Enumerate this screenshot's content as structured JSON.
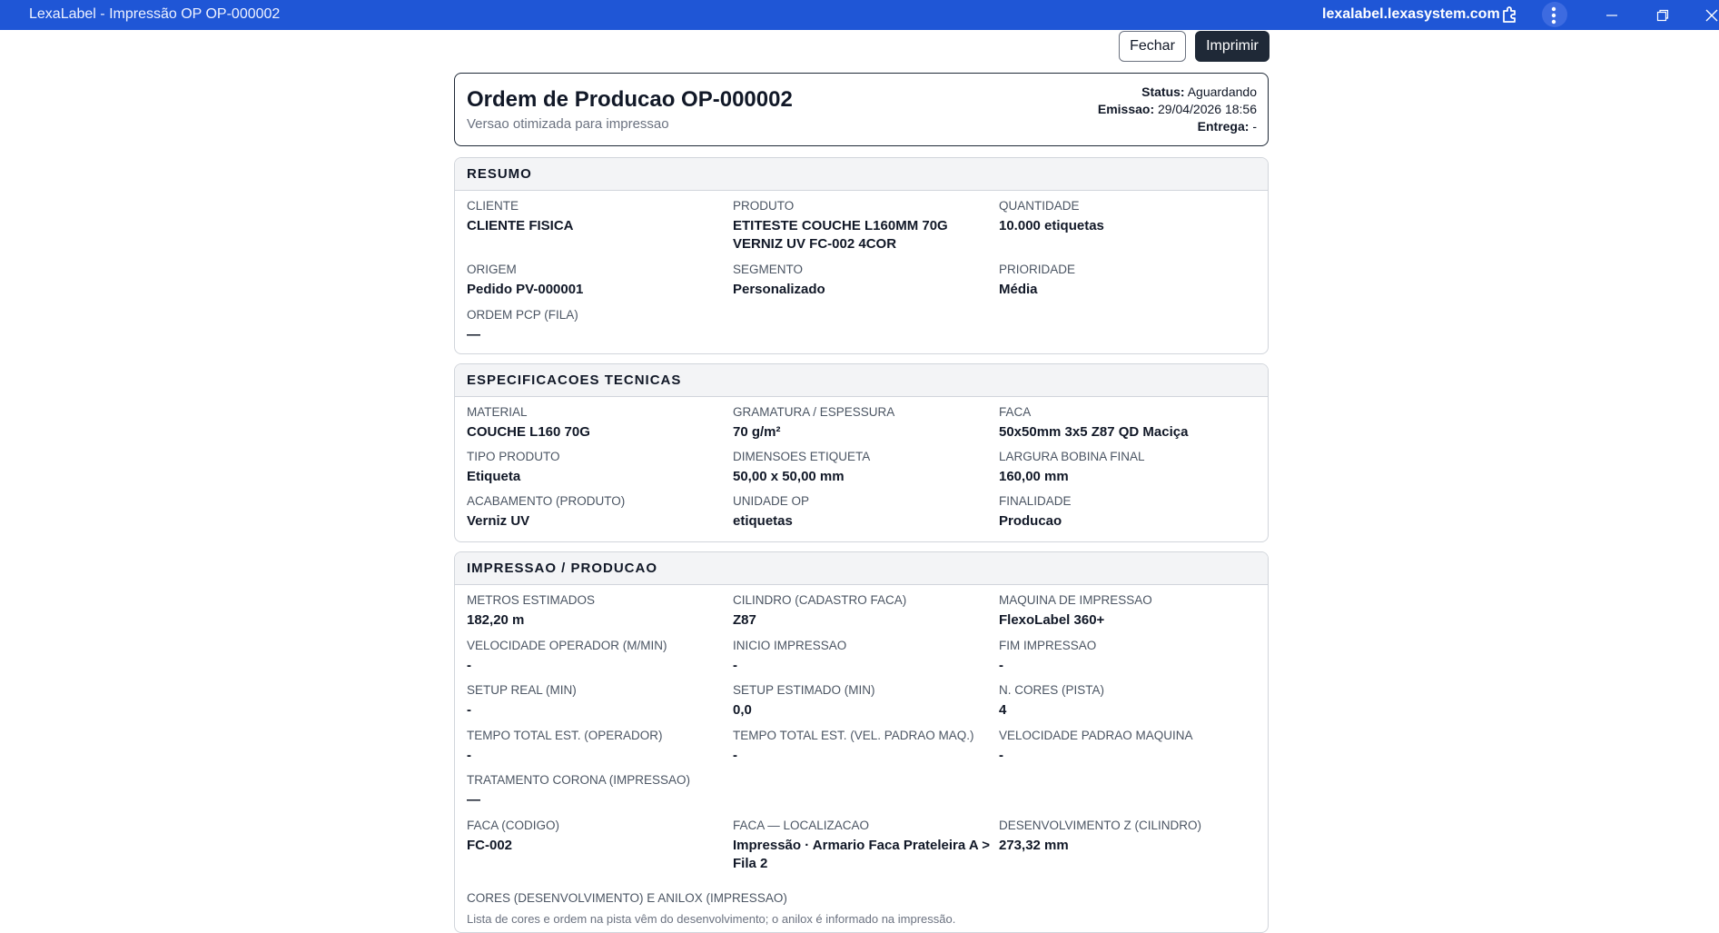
{
  "window": {
    "title": "LexaLabel - Impressão OP OP-000002",
    "domain": "lexalabel.lexasystem.com",
    "icons": [
      "extension-icon",
      "more-vert-icon",
      "minimize-icon",
      "restore-icon",
      "close-icon"
    ]
  },
  "toolbar": {
    "close_label": "Fechar",
    "print_label": "Imprimir"
  },
  "header": {
    "title": "Ordem de Producao OP-000002",
    "subtitle": "Versao otimizada para impressao",
    "status_label": "Status:",
    "status_value": "Aguardando",
    "emissao_label": "Emissao:",
    "emissao_value": "29/04/2026 18:56",
    "entrega_label": "Entrega:",
    "entrega_value": "-"
  },
  "resumo": {
    "title": "RESUMO",
    "fields": [
      {
        "label": "CLIENTE",
        "value": "CLIENTE FISICA"
      },
      {
        "label": "PRODUTO",
        "value": "ETITESTE COUCHE L160MM 70G VERNIZ UV FC-002 4COR"
      },
      {
        "label": "QUANTIDADE",
        "value": "10.000 etiquetas"
      },
      {
        "label": "ORIGEM",
        "value": "Pedido PV-000001"
      },
      {
        "label": "SEGMENTO",
        "value": "Personalizado"
      },
      {
        "label": "PRIORIDADE",
        "value": "Média"
      },
      {
        "label": "ORDEM PCP (FILA)",
        "value": "—"
      }
    ]
  },
  "specs": {
    "title": "ESPECIFICACOES TECNICAS",
    "fields": [
      {
        "label": "MATERIAL",
        "value": "COUCHE L160 70G"
      },
      {
        "label": "GRAMATURA / ESPESSURA",
        "value": "70 g/m²"
      },
      {
        "label": "FACA",
        "value": "50x50mm 3x5 Z87 QD Maciça"
      },
      {
        "label": "TIPO PRODUTO",
        "value": "Etiqueta"
      },
      {
        "label": "DIMENSOES ETIQUETA",
        "value": "50,00 x 50,00 mm"
      },
      {
        "label": "LARGURA BOBINA FINAL",
        "value": "160,00 mm"
      },
      {
        "label": "ACABAMENTO (PRODUTO)",
        "value": "Verniz UV"
      },
      {
        "label": "UNIDADE OP",
        "value": "etiquetas"
      },
      {
        "label": "FINALIDADE",
        "value": "Producao"
      }
    ]
  },
  "impressao": {
    "title": "IMPRESSAO / PRODUCAO",
    "fields": [
      {
        "label": "METROS ESTIMADOS",
        "value": "182,20 m"
      },
      {
        "label": "CILINDRO (CADASTRO FACA)",
        "value": "Z87"
      },
      {
        "label": "MAQUINA DE IMPRESSAO",
        "value": "FlexoLabel 360+"
      },
      {
        "label": "VELOCIDADE OPERADOR (M/MIN)",
        "value": "-"
      },
      {
        "label": "INICIO IMPRESSAO",
        "value": "-"
      },
      {
        "label": "FIM IMPRESSAO",
        "value": "-"
      },
      {
        "label": "SETUP REAL (MIN)",
        "value": "-"
      },
      {
        "label": "SETUP ESTIMADO (MIN)",
        "value": "0,0"
      },
      {
        "label": "N. CORES (PISTA)",
        "value": "4"
      },
      {
        "label": "TEMPO TOTAL EST. (OPERADOR)",
        "value": "-"
      },
      {
        "label": "TEMPO TOTAL EST. (VEL. PADRAO MAQ.)",
        "value": "-"
      },
      {
        "label": "VELOCIDADE PADRAO MAQUINA",
        "value": "-"
      },
      {
        "label": "TRATAMENTO CORONA (IMPRESSAO)",
        "value": "—"
      },
      {
        "label": "FACA (CODIGO)",
        "value": "FC-002"
      },
      {
        "label": "FACA — LOCALIZACAO",
        "value": "Impressão · Armario Faca Prateleira A > Fila 2"
      },
      {
        "label": "DESENVOLVIMENTO Z (CILINDRO)",
        "value": "273,32 mm"
      },
      {
        "label": "CORES (DESENVOLVIMENTO) E ANILOX (IMPRESSAO)",
        "value": ""
      }
    ],
    "note": "Lista de cores e ordem na pista vêm do desenvolvimento; o anilox é informado na impressão."
  }
}
